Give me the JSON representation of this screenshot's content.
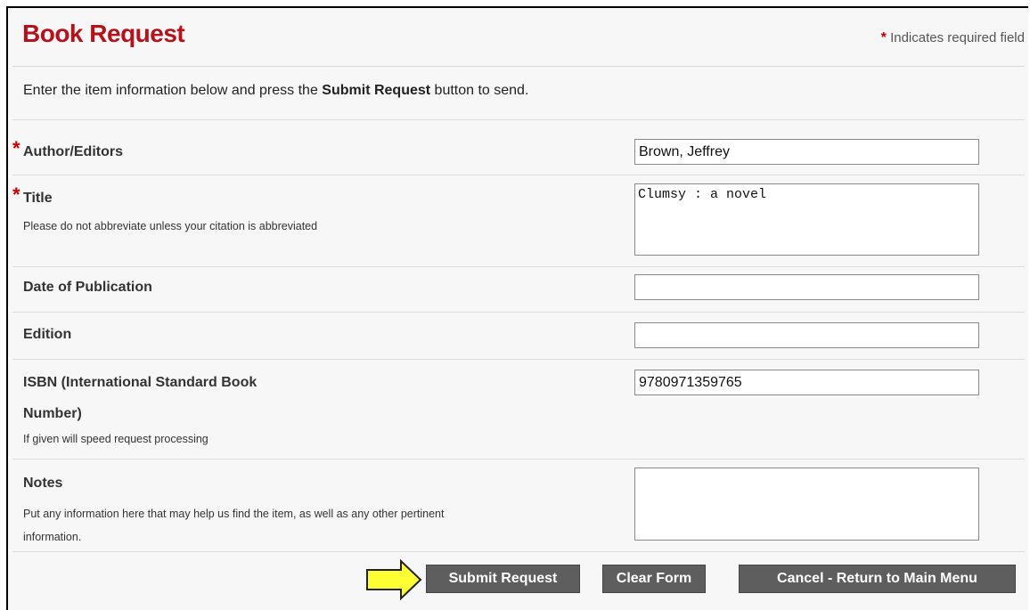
{
  "page": {
    "title": "Book Request",
    "required_marker": "*",
    "required_note": "Indicates required field",
    "intro_before": "Enter the item information below and press the ",
    "intro_bold": "Submit Request",
    "intro_after": " button to send."
  },
  "fields": {
    "author": {
      "label": "Author/Editors",
      "required": true,
      "value": "Brown, Jeffrey"
    },
    "title": {
      "label": "Title",
      "required": true,
      "hint": "Please do not abbreviate unless your citation is abbreviated",
      "value": "Clumsy : a novel"
    },
    "date": {
      "label": "Date of Publication",
      "value": ""
    },
    "edition": {
      "label": "Edition",
      "value": ""
    },
    "isbn": {
      "label_line1": "ISBN (International Standard Book",
      "label_line2": "Number)",
      "hint": "If given will speed request processing",
      "value": "9780971359765"
    },
    "notes": {
      "label": "Notes",
      "hint_line1": "Put any information here that may help us find the item, as well as any other pertinent",
      "hint_line2": "information.",
      "value": ""
    }
  },
  "buttons": {
    "submit": "Submit Request",
    "clear": "Clear Form",
    "cancel": "Cancel - Return to Main Menu"
  },
  "colors": {
    "title": "#b5121b",
    "required_star": "#cc0000",
    "button_bg": "#5e5e5e",
    "arrow_fill": "#ffff33"
  },
  "icons": {
    "pointer": "yellow-arrow-icon"
  }
}
